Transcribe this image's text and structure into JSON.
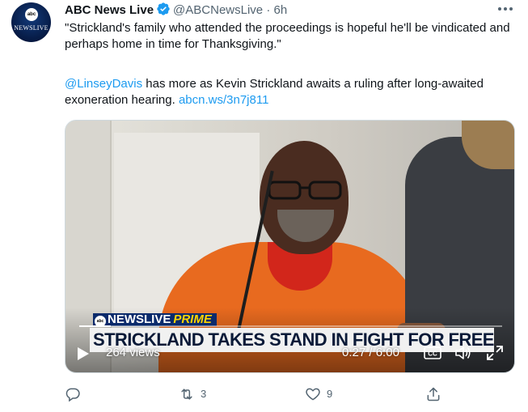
{
  "tweet": {
    "author_name": "ABC News Live",
    "handle": "@ABCNewsLive",
    "separator": "·",
    "time": "6h",
    "text_part1": "\"Strickland's family who attended the proceedings is hopeful he'll be vindicated and perhaps home in time for Thanksgiving.\"",
    "mention": "@LinseyDavis",
    "text_part2": " has more as Kevin Strickland awaits a ruling after long-awaited exoneration hearing. ",
    "link": "abcn.ws/3n7j811"
  },
  "avatar": {
    "logo_text": "abc",
    "brand_text": "NEWSLIVE"
  },
  "video": {
    "banner_brand": "NEWSLIVE",
    "banner_prime": "PRIME",
    "banner_logo": "abc",
    "headline": "STRICKLAND TAKES STAND IN FIGHT FOR FREEDOM",
    "views": "264 views",
    "time_current": "0:27",
    "time_separator": " / ",
    "time_total": "6:00",
    "progress_fraction": 0.075,
    "cc_label": "CC"
  },
  "actions": {
    "reply_count": "",
    "retweet_count": "3",
    "like_count": "9"
  },
  "colors": {
    "link": "#1d9bf0",
    "secondary_text": "#536471",
    "verified": "#1d9bf0",
    "jumpsuit": "#e86a1f",
    "banner_navy": "#0a2a6b",
    "banner_prime": "#ffd400"
  },
  "icons": [
    "verified-badge-icon",
    "more-icon",
    "play-icon",
    "closed-captions-icon",
    "volume-icon",
    "fullscreen-icon",
    "reply-icon",
    "retweet-icon",
    "like-icon",
    "share-icon"
  ]
}
